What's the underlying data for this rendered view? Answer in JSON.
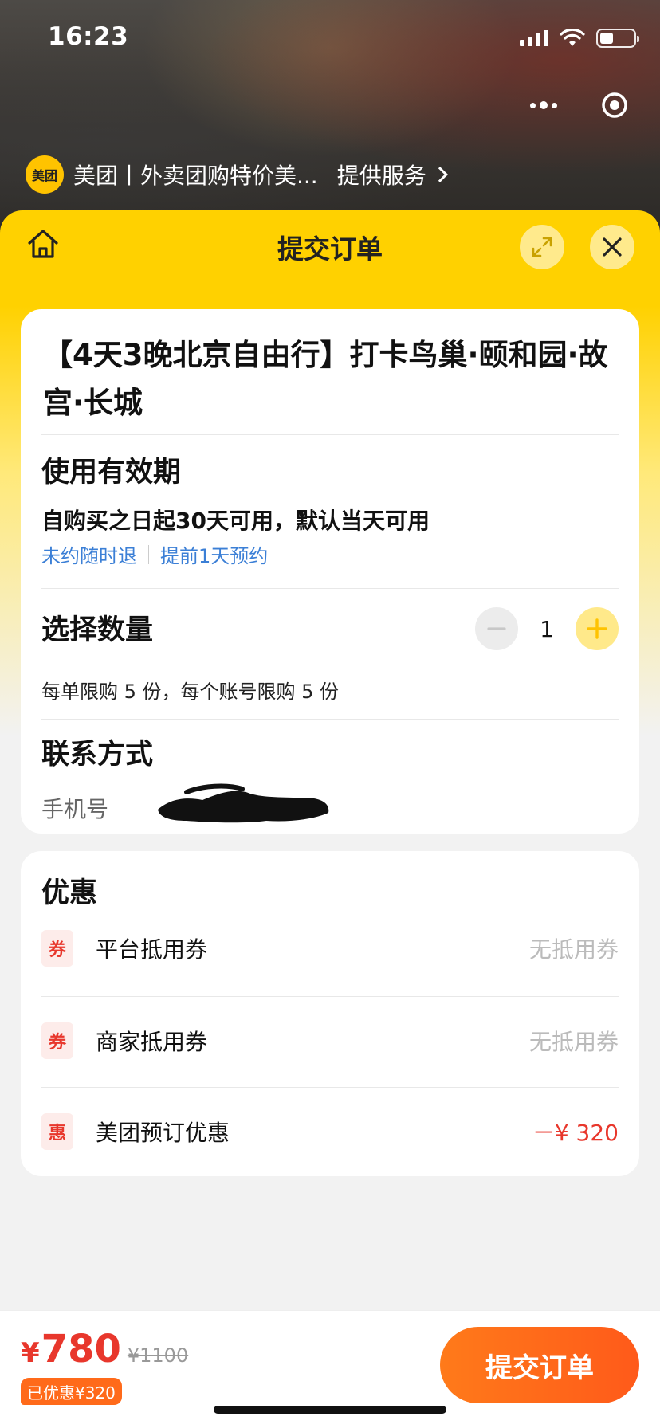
{
  "status": {
    "time": "16:23"
  },
  "miniapp": {
    "logo_text": "美团",
    "title": "美团丨外卖团购特价美...",
    "service_link": "提供服务"
  },
  "header": {
    "title": "提交订单"
  },
  "product": {
    "title": "【4天3晚北京自由行】打卡鸟巢·颐和园·故宫·长城"
  },
  "validity": {
    "title": "使用有效期",
    "text": "自购买之日起30天可用，默认当天可用",
    "tags": [
      "未约随时退",
      "提前1天预约"
    ]
  },
  "quantity": {
    "title": "选择数量",
    "value": "1",
    "limit_text": "每单限购 5 份，每个账号限购 5 份"
  },
  "contact": {
    "title": "联系方式",
    "phone_label": "手机号"
  },
  "discounts": {
    "title": "优惠",
    "rows": [
      {
        "badge": "券",
        "label": "平台抵用券",
        "value": "无抵用券"
      },
      {
        "badge": "券",
        "label": "商家抵用券",
        "value": "无抵用券"
      },
      {
        "badge": "惠",
        "label": "美团预订优惠",
        "value": "－¥ 320"
      }
    ]
  },
  "footer": {
    "currency": "¥",
    "price": "780",
    "original_price": "¥1100",
    "saved": "已优惠¥320",
    "submit_label": "提交订单"
  },
  "colors": {
    "brand_yellow": "#ffd100",
    "accent_red": "#e8372c",
    "accent_orange": "#ff6a1a",
    "link_blue": "#3b7fd6"
  },
  "icons": {
    "home": "home-icon",
    "expand": "expand-icon",
    "close": "close-icon",
    "more": "more-dots-icon",
    "target": "target-icon",
    "minus": "minus-icon",
    "plus": "plus-icon",
    "chevron": "chevron-right-icon"
  }
}
